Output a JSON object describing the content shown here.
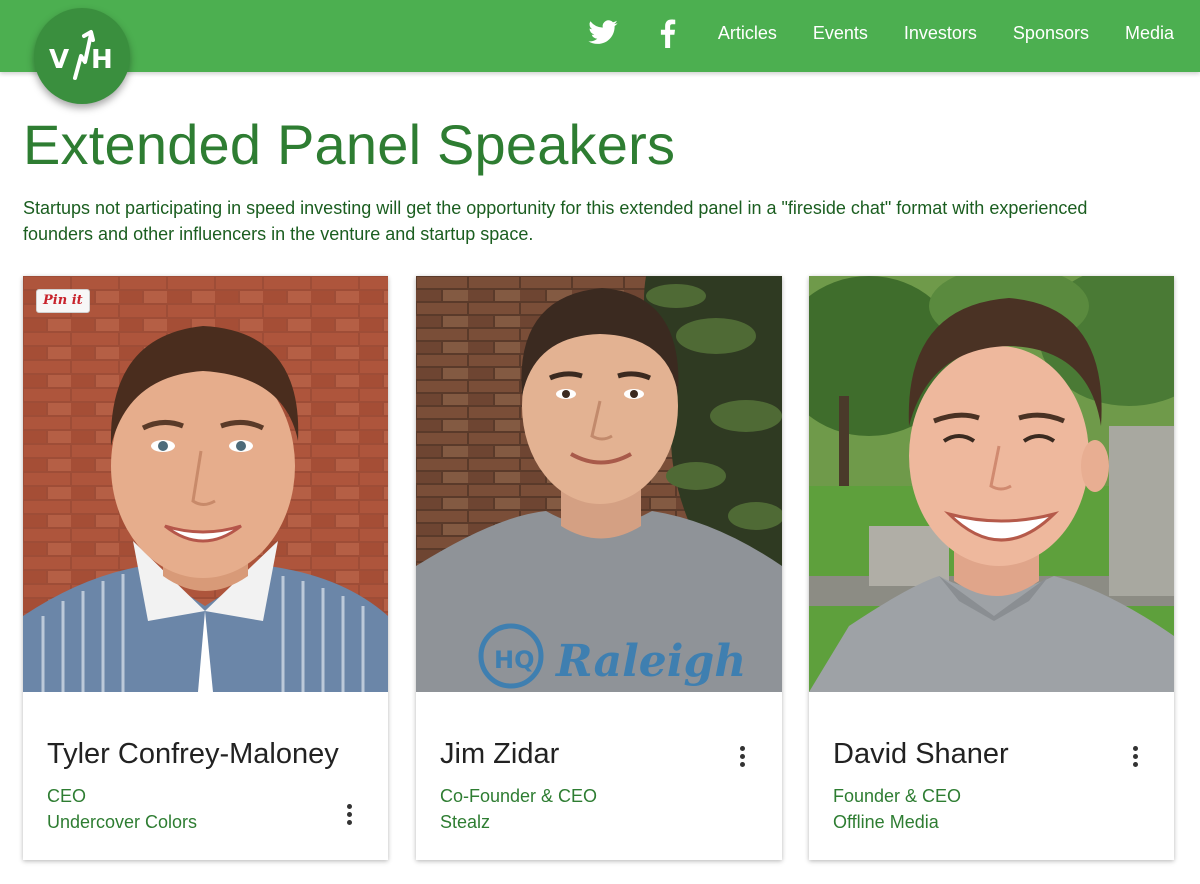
{
  "brand": {
    "logo_text": "V/H",
    "accent": "#4caf50",
    "dark": "#2e7d32"
  },
  "nav": {
    "icons": [
      "twitter-icon",
      "facebook-icon"
    ],
    "links": [
      "Articles",
      "Events",
      "Investors",
      "Sponsors",
      "Media"
    ]
  },
  "page": {
    "title": "Extended Panel Speakers",
    "intro": "Startups not participating in speed investing will get the opportunity for this extended panel in a \"fireside chat\" format with experienced founders and other influencers in the venture and startup space."
  },
  "speakers": [
    {
      "name": "Tyler Confrey-Maloney",
      "role": "CEO",
      "company": "Undercover Colors",
      "pin_label": "Pin it"
    },
    {
      "name": "Jim Zidar",
      "role": "Co-Founder & CEO",
      "company": "Stealz",
      "shirt_text": "Raleigh",
      "shirt_logo": "HQ"
    },
    {
      "name": "David Shaner",
      "role": "Founder & CEO",
      "company": "Offline Media"
    }
  ]
}
